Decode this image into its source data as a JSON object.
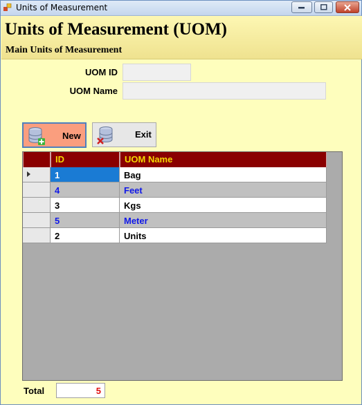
{
  "window": {
    "title": "Units of Measurement"
  },
  "header": {
    "title": "Units of Measurement (UOM)",
    "subtitle": "Main Units of Measurement"
  },
  "form": {
    "uom_id_label": "UOM ID",
    "uom_id_value": "",
    "uom_name_label": "UOM Name",
    "uom_name_value": ""
  },
  "toolbar": {
    "new_label": "New",
    "exit_label": "Exit"
  },
  "grid": {
    "columns": [
      "ID",
      "UOM Name"
    ],
    "rows": [
      {
        "id": "1",
        "name": "Bag"
      },
      {
        "id": "4",
        "name": "Feet"
      },
      {
        "id": "3",
        "name": "Kgs"
      },
      {
        "id": "5",
        "name": "Meter"
      },
      {
        "id": "2",
        "name": "Units"
      }
    ]
  },
  "footer": {
    "total_label": "Total",
    "total_value": "5"
  },
  "colors": {
    "background": "#fefebd",
    "grid_header": "#8a0000",
    "header_text": "#f5d800",
    "selected": "#1a7bd4",
    "alt_text": "#1018e8",
    "total_text": "#e01010"
  }
}
